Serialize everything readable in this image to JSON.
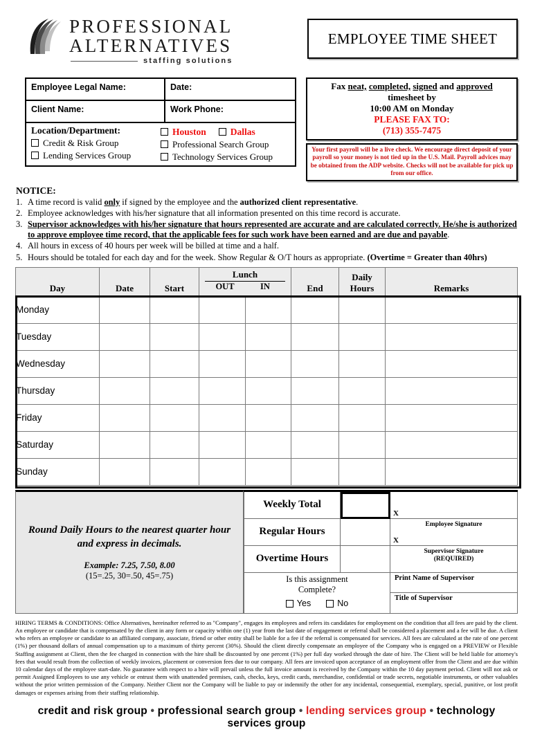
{
  "brand": {
    "line1": "PROFESSIONAL",
    "line2": "ALTERNATIVES",
    "tagline": "staffing solutions",
    "logo_icon": "swoosh-logo-icon"
  },
  "title": "EMPLOYEE TIME SHEET",
  "fields": {
    "employee_legal_name_label": "Employee Legal Name:",
    "date_label": "Date:",
    "client_name_label": "Client Name:",
    "work_phone_label": "Work Phone:",
    "employee_legal_name_value": "",
    "date_value": "",
    "client_name_value": "",
    "work_phone_value": ""
  },
  "location": {
    "label": "Location/Department:",
    "cities": [
      "Houston",
      "Dallas"
    ],
    "city_color": "#ee1111",
    "departments_left": [
      "Credit & Risk Group",
      "Lending Services Group"
    ],
    "departments_right": [
      "Professional Search Group",
      "Technology Services Group"
    ]
  },
  "fax_box": {
    "line1_pre": "Fax ",
    "line1_u1": "neat,",
    "line1_u2": "completed,",
    "line1_u3": "signed",
    "line1_and": " and ",
    "line1_u4": "approved",
    "line2": "timesheet by",
    "line3": "10:00 AM on Monday",
    "fax_to": "PLEASE FAX TO:",
    "fax_number": "(713) 355-7475",
    "accent_color": "#ee1111"
  },
  "payroll_notice": {
    "text": "Your first payroll will be a live check. We encourage direct deposit of your payroll so your money is not tied up in the U.S. Mail.  Payroll advices may be obtained from the ADP website. Checks will not be available for pick up from our office.",
    "color": "#cc1111"
  },
  "notice": {
    "title": "NOTICE:",
    "items": [
      {
        "num": "1.",
        "html": "A time record is valid <b><u>only</u></b> if signed by the employee and the <b>authorized client representative</b>."
      },
      {
        "num": "2.",
        "html": "Employee acknowledges with his/her signature that all information presented on this time record is accurate."
      },
      {
        "num": "3.",
        "html": "<span class=\"nbold\">Supervisor acknowledges with his/her signature that hours represented are accurate and are calculated correctly.  He/she is authorized to approve employee time record, that the applicable fees for such work have been earned and are due and payable</span>."
      },
      {
        "num": "4.",
        "html": "All hours in excess of 40 hours per week will be billed at time and a half."
      },
      {
        "num": "5.",
        "html": "Hours should be totaled for each day and for the week.   Show Regular &amp; O/T hours as appropriate. <b>(Overtime = Greater than 40hrs)</b>"
      }
    ]
  },
  "time_table": {
    "headers": {
      "day": "Day",
      "date": "Date",
      "start": "Start",
      "lunch": "Lunch",
      "lunch_out": "OUT",
      "lunch_in": "IN",
      "end": "End",
      "daily_hours_line1": "Daily",
      "daily_hours_line2": "Hours",
      "remarks": "Remarks"
    },
    "rows": [
      {
        "day": "Monday",
        "date": "",
        "start": "",
        "lunch_out": "",
        "lunch_in": "",
        "end": "",
        "daily_hours": "",
        "remarks": ""
      },
      {
        "day": "Tuesday",
        "date": "",
        "start": "",
        "lunch_out": "",
        "lunch_in": "",
        "end": "",
        "daily_hours": "",
        "remarks": ""
      },
      {
        "day": "Wednesday",
        "date": "",
        "start": "",
        "lunch_out": "",
        "lunch_in": "",
        "end": "",
        "daily_hours": "",
        "remarks": ""
      },
      {
        "day": "Thursday",
        "date": "",
        "start": "",
        "lunch_out": "",
        "lunch_in": "",
        "end": "",
        "daily_hours": "",
        "remarks": ""
      },
      {
        "day": "Friday",
        "date": "",
        "start": "",
        "lunch_out": "",
        "lunch_in": "",
        "end": "",
        "daily_hours": "",
        "remarks": ""
      },
      {
        "day": "Saturday",
        "date": "",
        "start": "",
        "lunch_out": "",
        "lunch_in": "",
        "end": "",
        "daily_hours": "",
        "remarks": ""
      },
      {
        "day": "Sunday",
        "date": "",
        "start": "",
        "lunch_out": "",
        "lunch_in": "",
        "end": "",
        "daily_hours": "",
        "remarks": ""
      }
    ]
  },
  "rounding": {
    "main_line1": "Round Daily Hours to the nearest quarter hour",
    "main_line2": "and express in decimals.",
    "example": "Example: 7.25, 7.50, 8.00",
    "example_sub": "(15=.25, 30=.50, 45=.75)"
  },
  "totals": {
    "weekly_total_label": "Weekly Total",
    "weekly_total_value": "",
    "regular_hours_label": "Regular Hours",
    "regular_hours_value": "",
    "overtime_hours_label": "Overtime Hours",
    "overtime_hours_value": "",
    "employee_signature_caption": "Employee Signature",
    "supervisor_signature_caption_line1": "Supervisor Signature",
    "supervisor_signature_caption_line2": "(REQUIRED)",
    "signature_x": "X",
    "employee_signature_value": "",
    "supervisor_signature_value": ""
  },
  "assignment": {
    "question_line1": "Is this assignment",
    "question_line2": "Complete?",
    "yes_label": "Yes",
    "no_label": "No",
    "print_name_label": "Print Name of Supervisor",
    "print_name_value": "",
    "title_label": "Title of Supervisor",
    "title_value": ""
  },
  "terms": {
    "text": "HIRING TERMS & CONDITIONS: Office Alternatives, hereinafter referred to as \"Company\", engages its employees and refers its candidates for employment on the condition that all fees are paid by the client. An employee or candidate that is compensated by the client in any form or capacity within one (1) year from the last date of engagement or referral shall be considered a placement and a fee will be due. A client who refers an employee or candidate to an affiliated company, associate, friend or other entity shall be liable for a fee if the referral is compensated for services. All fees are calculated at the rate of one percent (1%) per thousand dollars of annual compensation up to a maximum of thirty percent (30%). Should the client directly compensate an employee of the Company who is engaged on a PREVIEW or Flexible Staffing assignment at Client, then the fee charged in connection with the hire shall be discounted by one percent (1%) per full day worked through the date of hire. The Client will be held liable for attorney's fees that would result from the collection of weekly invoices, placement or conversion fees due to our company.  All fees are invoiced upon acceptance of an employment offer from the Client and are due within 10 calendar days of the employee start-date. No guarantee with respect to a hire will prevail unless the full invoice amount is received by the Company within the 10 day payment period.  Client will not ask or permit Assigned Employees to use any vehicle or entrust them with unattended premises, cash, checks, keys, credit cards, merchandise, confidential or trade secrets, negotiable instruments, or other valuables without the prior written permission of the Company.  Neither Client nor the Company will be liable to pay or indemnify the other for any incidental, consequential, exemplary, special, punitive, or lost profit damages or expenses arising from their staffing relationship."
  },
  "footer": {
    "item1": "credit and risk group",
    "item2": "professional search group",
    "item3": "lending services group",
    "item4": "technology services group",
    "separator": "•",
    "highlight_color": "#dd2222"
  }
}
